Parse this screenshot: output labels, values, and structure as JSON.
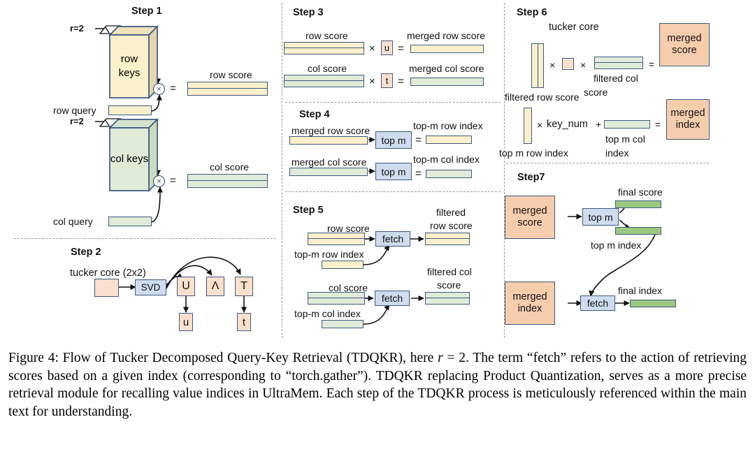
{
  "figure": {
    "steps": {
      "step1": "Step 1",
      "step2": "Step 2",
      "step3": "Step 3",
      "step4": "Step 4",
      "step5": "Step 5",
      "step6": "Step 6",
      "step7": "Step7"
    },
    "step1": {
      "rank_row": "r=2",
      "rank_col": "r=2",
      "row_keys": "row\nkeys",
      "row_keys_line1": "row",
      "row_keys_line2": "keys",
      "col_keys": "col keys",
      "row_query": "row query",
      "col_query": "col query",
      "row_score": "row score",
      "col_score": "col score",
      "times": "×",
      "equals": "="
    },
    "step2": {
      "tucker_core": "tucker core (2x2)",
      "svd": "SVD",
      "u_big": "U",
      "lambda": "Λ",
      "t_big": "T",
      "u_small": "u",
      "t_small": "t"
    },
    "step3": {
      "row_score": "row score",
      "col_score": "col score",
      "u": "u",
      "t": "t",
      "merged_row_score": "merged row score",
      "merged_col_score": "merged col score",
      "times": "×",
      "equals": "="
    },
    "step4": {
      "merged_row_score": "merged row score",
      "merged_col_score": "merged col score",
      "top_m": "top m",
      "topm_row_index": "top-m row index",
      "topm_col_index": "top-m col index",
      "equals": "="
    },
    "step5": {
      "row_score": "row score",
      "col_score": "col score",
      "topm_row_index": "top-m row index",
      "topm_col_index": "top-m col index",
      "fetch": "fetch",
      "filtered_row_score_l1": "filtered",
      "filtered_row_score_l2": "row score",
      "filtered_col_score_l1": "filtered col",
      "filtered_col_score_l2": "score"
    },
    "step6": {
      "tucker_core": "tucker core",
      "filtered_row_score": "filtered row score",
      "filtered_col_score_l1": "filtered col",
      "filtered_col_score_l2": "score",
      "merged_score_l1": "merged",
      "merged_score_l2": "score",
      "top_m_row_index": "top m row index",
      "top_m_col_index_l1": "top m col",
      "top_m_col_index_l2": "index",
      "merged_index_l1": "merged",
      "merged_index_l2": "index",
      "key_num": "key_num",
      "times": "×",
      "plus": "+",
      "equals": "="
    },
    "step7": {
      "merged_score_l1": "merged",
      "merged_score_l2": "score",
      "merged_index_l1": "merged",
      "merged_index_l2": "index",
      "top_m": "top m",
      "fetch": "fetch",
      "final_score": "final score",
      "top_m_index": "top m index",
      "final_index": "final index"
    }
  },
  "caption": {
    "full": "Figure 4: Flow of Tucker Decomposed Query-Key Retrieval (TDQKR), here r = 2. The term “fetch” refers to the action of retrieving scores based on a given index (corresponding to “torch.gather”). TDQKR replacing Product Quantization, serves as a more precise retrieval module for recalling value indices in UltraMem. Each step of the TDQKR process is meticulously referenced within the main text for understanding.",
    "label": "Figure 4:",
    "part1": "Flow of Tucker Decomposed Query-Key Retrieval (TDQKR), here ",
    "math_r": "r",
    "math_eq": " = ",
    "math_val": "2",
    "part2": ". The term “fetch” refers to the action of retrieving scores based on a given index (corresponding to “torch.gather”). TDQKR replacing Product Quantization, serves as a more precise retrieval module for recalling value indices in UltraMem. Each step of the TDQKR process is meticulously referenced within the main text for understanding."
  },
  "colors": {
    "yellow_fill": "#fbf0cb",
    "green_fill": "#e0ebd8",
    "green_solid": "#9cc97f",
    "peach_fill": "#f7cdae",
    "light_peach_fill": "#fbe0cd",
    "blue_fill": "#cfdcee",
    "stroke": "#3c5a82",
    "divider": "#9a9a9a"
  }
}
